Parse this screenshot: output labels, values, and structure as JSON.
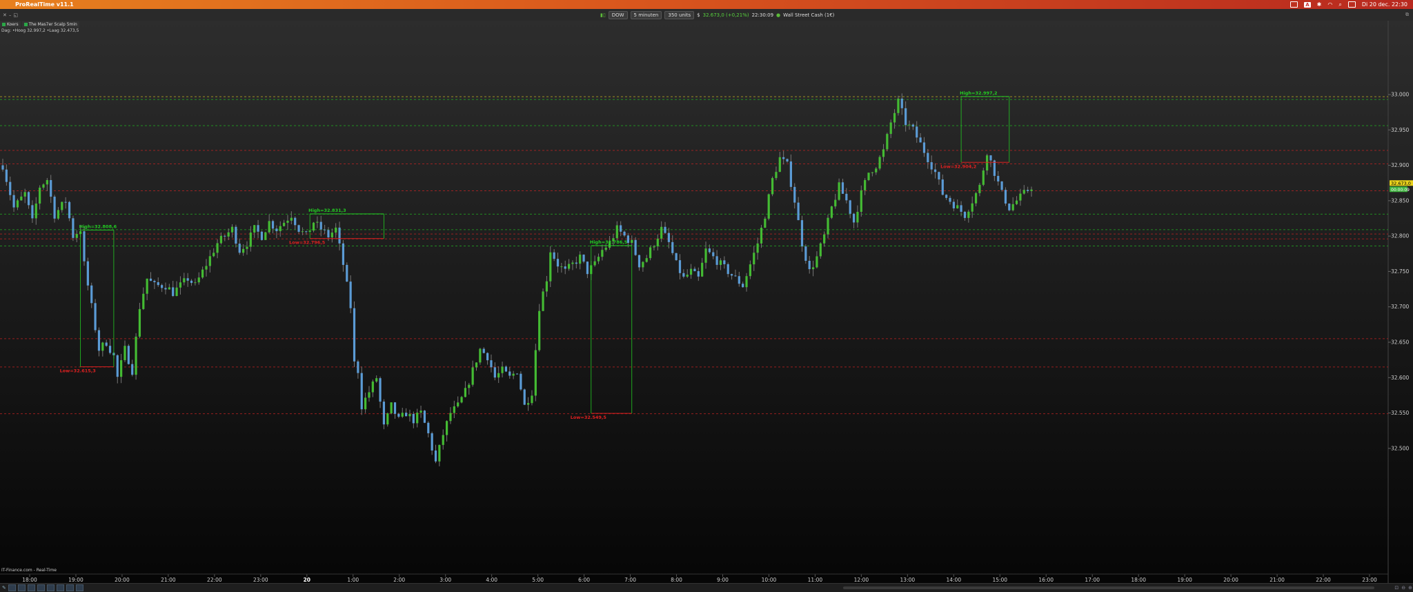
{
  "menubar": {
    "app_title": "ProRealTime v11.1",
    "clock": "Di 20 dec.  22:30"
  },
  "toolbar": {
    "instrument": "DOW",
    "timeframe": "5 minuten",
    "units": "350 units",
    "currency_icon": "$",
    "price": "32.673,0 (+0,21%)",
    "time": "22:30:09",
    "market": "Wall Street Cash (1€)"
  },
  "tabs": [
    "Koers",
    "The Mas7er Scalp 5min"
  ],
  "day_info": "Dag: •Hoog 32.997,2 •Laag 32.473,5",
  "source": "IT-Finance.com - Real-Time",
  "colors": {
    "up": "#44bb33",
    "down": "#5b9bd5",
    "high": "#22cc22",
    "low": "#e02020"
  },
  "chart_data": {
    "type": "candlestick",
    "ylim": [
      32455,
      33040
    ],
    "y_ticks": [
      "33.000",
      "32.950",
      "32.900",
      "32.850",
      "32.800",
      "32.750",
      "32.700",
      "32.650",
      "32.600",
      "32.550",
      "32.500"
    ],
    "x_ticks": [
      "18:00",
      "19:00",
      "20:00",
      "21:00",
      "22:00",
      "23:00",
      "20",
      "1:00",
      "2:00",
      "3:00",
      "4:00",
      "5:00",
      "6:00",
      "7:00",
      "8:00",
      "9:00",
      "10:00",
      "11:00",
      "12:00",
      "13:00",
      "14:00",
      "15:00",
      "16:00",
      "17:00",
      "18:00",
      "19:00",
      "20:00",
      "21:00",
      "22:00",
      "23:00"
    ],
    "price_labels": [
      "32.673,0",
      "00:00:09"
    ],
    "close_path": [
      [
        0,
        32900
      ],
      [
        3,
        32840
      ],
      [
        6,
        32860
      ],
      [
        8,
        32820
      ],
      [
        10,
        32870
      ],
      [
        12,
        32880
      ],
      [
        14,
        32830
      ],
      [
        17,
        32850
      ],
      [
        19,
        32800
      ],
      [
        21,
        32810
      ],
      [
        22,
        32760
      ],
      [
        24,
        32700
      ],
      [
        26,
        32640
      ],
      [
        28,
        32650
      ],
      [
        30,
        32630
      ],
      [
        31,
        32600
      ],
      [
        33,
        32640
      ],
      [
        35,
        32610
      ],
      [
        37,
        32700
      ],
      [
        39,
        32740
      ],
      [
        41,
        32730
      ],
      [
        44,
        32730
      ],
      [
        46,
        32720
      ],
      [
        48,
        32730
      ],
      [
        50,
        32740
      ],
      [
        52,
        32730
      ],
      [
        54,
        32750
      ],
      [
        56,
        32770
      ],
      [
        58,
        32790
      ],
      [
        60,
        32800
      ],
      [
        62,
        32810
      ],
      [
        64,
        32780
      ],
      [
        66,
        32790
      ],
      [
        68,
        32810
      ],
      [
        70,
        32800
      ],
      [
        72,
        32820
      ],
      [
        74,
        32810
      ],
      [
        76,
        32820
      ],
      [
        78,
        32830
      ],
      [
        80,
        32810
      ],
      [
        82,
        32800
      ],
      [
        84,
        32820
      ],
      [
        86,
        32810
      ],
      [
        88,
        32800
      ],
      [
        90,
        32810
      ],
      [
        92,
        32760
      ],
      [
        94,
        32700
      ],
      [
        95,
        32620
      ],
      [
        96,
        32610
      ],
      [
        97,
        32560
      ],
      [
        99,
        32580
      ],
      [
        101,
        32600
      ],
      [
        103,
        32530
      ],
      [
        105,
        32560
      ],
      [
        107,
        32540
      ],
      [
        109,
        32550
      ],
      [
        111,
        32540
      ],
      [
        113,
        32550
      ],
      [
        115,
        32520
      ],
      [
        117,
        32480
      ],
      [
        119,
        32520
      ],
      [
        121,
        32550
      ],
      [
        123,
        32560
      ],
      [
        125,
        32580
      ],
      [
        127,
        32610
      ],
      [
        129,
        32640
      ],
      [
        131,
        32630
      ],
      [
        133,
        32600
      ],
      [
        135,
        32610
      ],
      [
        137,
        32600
      ],
      [
        139,
        32610
      ],
      [
        141,
        32560
      ],
      [
        143,
        32580
      ],
      [
        145,
        32700
      ],
      [
        147,
        32740
      ],
      [
        148,
        32780
      ],
      [
        150,
        32760
      ],
      [
        152,
        32750
      ],
      [
        154,
        32760
      ],
      [
        156,
        32770
      ],
      [
        158,
        32750
      ],
      [
        160,
        32760
      ],
      [
        162,
        32780
      ],
      [
        164,
        32790
      ],
      [
        166,
        32810
      ],
      [
        168,
        32800
      ],
      [
        170,
        32790
      ],
      [
        172,
        32760
      ],
      [
        174,
        32770
      ],
      [
        176,
        32790
      ],
      [
        178,
        32810
      ],
      [
        180,
        32790
      ],
      [
        182,
        32760
      ],
      [
        184,
        32740
      ],
      [
        186,
        32750
      ],
      [
        188,
        32740
      ],
      [
        190,
        32780
      ],
      [
        192,
        32770
      ],
      [
        194,
        32760
      ],
      [
        196,
        32750
      ],
      [
        198,
        32740
      ],
      [
        200,
        32730
      ],
      [
        202,
        32760
      ],
      [
        204,
        32790
      ],
      [
        206,
        32830
      ],
      [
        208,
        32880
      ],
      [
        210,
        32910
      ],
      [
        212,
        32900
      ],
      [
        214,
        32850
      ],
      [
        216,
        32790
      ],
      [
        218,
        32750
      ],
      [
        220,
        32770
      ],
      [
        222,
        32800
      ],
      [
        224,
        32840
      ],
      [
        226,
        32870
      ],
      [
        228,
        32850
      ],
      [
        230,
        32820
      ],
      [
        232,
        32860
      ],
      [
        234,
        32890
      ],
      [
        236,
        32900
      ],
      [
        238,
        32920
      ],
      [
        240,
        32960
      ],
      [
        242,
        32990
      ],
      [
        244,
        32960
      ],
      [
        246,
        32950
      ],
      [
        248,
        32930
      ],
      [
        250,
        32910
      ],
      [
        252,
        32890
      ],
      [
        254,
        32860
      ],
      [
        256,
        32850
      ],
      [
        258,
        32840
      ],
      [
        260,
        32830
      ],
      [
        262,
        32850
      ],
      [
        264,
        32870
      ],
      [
        266,
        32920
      ],
      [
        268,
        32890
      ],
      [
        270,
        32860
      ],
      [
        272,
        32840
      ],
      [
        274,
        32850
      ],
      [
        276,
        32860
      ],
      [
        278,
        32870
      ]
    ],
    "levels": [
      {
        "value": 32997,
        "style": "dashed",
        "color": "#bbaa22"
      },
      {
        "value": 32993,
        "style": "dashed",
        "color": "#22aa22"
      },
      {
        "value": 32956,
        "style": "dashed",
        "color": "#22aa22"
      },
      {
        "value": 32921,
        "style": "dashed",
        "color": "#bb2222"
      },
      {
        "value": 32902,
        "style": "dashed",
        "color": "#bb2222"
      },
      {
        "value": 32864,
        "style": "dashed",
        "color": "#bb2222"
      },
      {
        "value": 32831,
        "style": "dashed",
        "color": "#22aa22"
      },
      {
        "value": 32809,
        "style": "dashed",
        "color": "#22aa22"
      },
      {
        "value": 32803,
        "style": "dashed",
        "color": "#bb2222"
      },
      {
        "value": 32796,
        "style": "dashed",
        "color": "#bb2222"
      },
      {
        "value": 32786,
        "style": "dashed",
        "color": "#22aa22"
      },
      {
        "value": 32655,
        "style": "dashed",
        "color": "#bb2222"
      },
      {
        "value": 32615,
        "style": "dashed",
        "color": "#bb2222"
      },
      {
        "value": 32549,
        "style": "dashed",
        "color": "#bb2222"
      }
    ],
    "boxes": [
      {
        "high": 32808.6,
        "low": 32615.3,
        "x0": 21,
        "x1": 30,
        "high_label": "High=32.808,6",
        "low_label": "Low=32.615,3"
      },
      {
        "high": 32831.3,
        "low": 32796.5,
        "x0": 83,
        "x1": 103,
        "high_label": "High=32.831,3",
        "low_label": "Low=32.796,5"
      },
      {
        "high": 32786.5,
        "low": 32549.5,
        "x0": 159,
        "x1": 170,
        "high_label": "High=32.786,5",
        "low_label": "Low=32.549,5"
      },
      {
        "high": 32997.2,
        "low": 32904.2,
        "x0": 259,
        "x1": 272,
        "high_label": "High=32.997,2",
        "low_label": "Low=32.904,2"
      }
    ]
  }
}
